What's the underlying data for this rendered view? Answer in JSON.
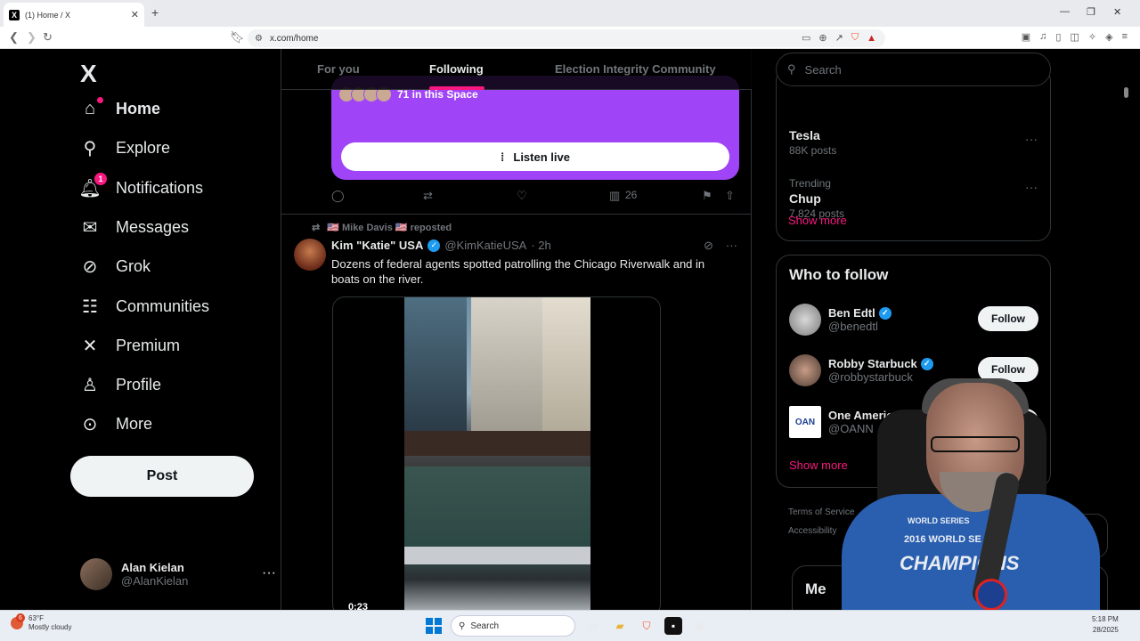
{
  "browser": {
    "tab_title": "(1) Home / X",
    "tab_favicon": "X",
    "url": "x.com/home"
  },
  "nav": {
    "logo": "X",
    "items": [
      {
        "label": "Home",
        "icon": "home-icon",
        "badge": ""
      },
      {
        "label": "Explore",
        "icon": "search-icon",
        "badge": ""
      },
      {
        "label": "Notifications",
        "icon": "bell-icon",
        "badge": "1"
      },
      {
        "label": "Messages",
        "icon": "envelope-icon",
        "badge": ""
      },
      {
        "label": "Grok",
        "icon": "grok-icon",
        "badge": ""
      },
      {
        "label": "Communities",
        "icon": "people-icon",
        "badge": ""
      },
      {
        "label": "Premium",
        "icon": "x-icon",
        "badge": ""
      },
      {
        "label": "Profile",
        "icon": "person-icon",
        "badge": ""
      },
      {
        "label": "More",
        "icon": "more-circle-icon",
        "badge": ""
      }
    ],
    "post_label": "Post",
    "account": {
      "name": "Alan Kielan",
      "handle": "@AlanKielan"
    }
  },
  "timeline": {
    "tabs": [
      "For you",
      "Following",
      "Election Integrity Community"
    ],
    "selected_tab": "Following",
    "space": {
      "listeners": "71 in this Space",
      "listen_label": "Listen live"
    },
    "space_actions": {
      "views": "26"
    },
    "tweet": {
      "repost_text": "🇺🇸 Mike Davis 🇺🇸 reposted",
      "name": "Kim \"Katie\" USA",
      "handle": "@KimKatieUSA",
      "time": "· 2h",
      "text": "Dozens of federal agents spotted patrolling the Chicago Riverwalk and in boats on the river.",
      "video_time": "0:23"
    }
  },
  "sidebar": {
    "search_placeholder": "Search",
    "trends": [
      {
        "category": "",
        "name": "Tesla",
        "posts": "88K posts"
      },
      {
        "category": "Trending",
        "name": "Chup",
        "posts": "7,824 posts"
      }
    ],
    "trends_show_more": "Show more",
    "who_to_follow": {
      "title": "Who to follow",
      "people": [
        {
          "name": "Ben Edtl",
          "handle": "@benedtl",
          "verified": true
        },
        {
          "name": "Robby Starbuck",
          "handle": "@robbystarbuck",
          "verified": true
        },
        {
          "name": "One America New",
          "handle": "@OANN",
          "verified": false
        }
      ],
      "follow_label": "Follow",
      "show_more": "Show more"
    },
    "footer": [
      "Terms of Service",
      "Accessibility"
    ],
    "messages_label": "Me"
  },
  "overlay": {
    "shirt_top": "WORLD SERIES",
    "shirt_main": "CHAMPIONS",
    "shirt_year": "2016 WORLD SE"
  },
  "taskbar": {
    "temp": "63°F",
    "weather": "Mostly cloudy",
    "weather_badge": "6",
    "search": "Search",
    "time": "5:18 PM",
    "date": "28/2025"
  },
  "colors": {
    "accent": "#f91880",
    "space": "#a044f7",
    "verified": "#1d9bf0"
  }
}
